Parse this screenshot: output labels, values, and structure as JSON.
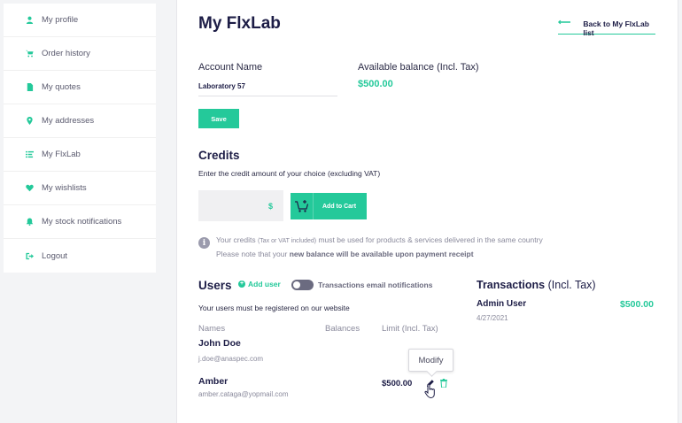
{
  "sidebar": {
    "items": [
      {
        "label": "My profile",
        "icon": "user-icon"
      },
      {
        "label": "Order history",
        "icon": "cart-icon"
      },
      {
        "label": "My quotes",
        "icon": "document-icon"
      },
      {
        "label": "My addresses",
        "icon": "map-pin-icon"
      },
      {
        "label": "My FlxLab",
        "icon": "list-icon"
      },
      {
        "label": "My wishlists",
        "icon": "heart-icon"
      },
      {
        "label": "My stock notifications",
        "icon": "bell-icon"
      },
      {
        "label": "Logout",
        "icon": "logout-icon"
      }
    ]
  },
  "page": {
    "title": "My FlxLab",
    "back_link": "Back to My FlxLab list"
  },
  "account": {
    "name_label": "Account Name",
    "name_value": "Laboratory 57",
    "balance_label": "Available balance (Incl. Tax)",
    "balance_value": "$500.00",
    "save_label": "Save"
  },
  "credits": {
    "heading": "Credits",
    "instructions": "Enter the credit amount of your choice (excluding VAT)",
    "currency_symbol": "$",
    "add_to_cart_label": "Add to Cart",
    "info_line1_a": "Your credits",
    "info_line1_small": "(Tax or VAT included)",
    "info_line1_b": "must be used for products & services delivered in the same country",
    "info_line2_a": "Please note that your",
    "info_line2_bold": "new balance will be available upon payment receipt"
  },
  "users": {
    "heading": "Users",
    "add_user_label": "Add user",
    "toggle_label": "Transactions email notifications",
    "toggle_on": false,
    "note": "Your users must be registered on our website",
    "columns": [
      "Names",
      "Balances",
      "Limit (Incl. Tax)"
    ],
    "rows": [
      {
        "name": "John Doe",
        "email": "j.doe@anaspec.com",
        "balance": "",
        "limit": ""
      },
      {
        "name": "Amber",
        "email": "amber.cataga@yopmail.com",
        "balance": "",
        "limit": "$500.00"
      }
    ],
    "tooltip": "Modify"
  },
  "transactions": {
    "heading": "Transactions",
    "heading_suffix": "(Incl. Tax)",
    "items": [
      {
        "user": "Admin User",
        "date": "4/27/2021",
        "amount": "$500.00"
      }
    ]
  },
  "colors": {
    "accent": "#24c99a",
    "heading": "#1d1d46",
    "muted": "#8a8a9c"
  }
}
